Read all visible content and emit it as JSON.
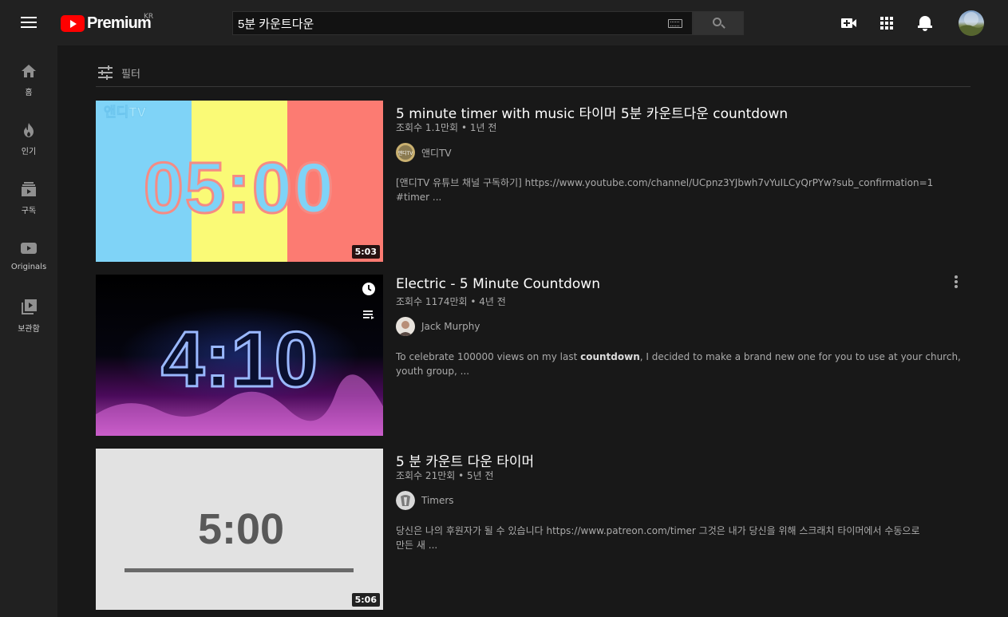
{
  "header": {
    "logo_text": "Premium",
    "logo_region": "KR",
    "search_value": "5분 카운트다운"
  },
  "sidebar": {
    "items": [
      {
        "label": "홈",
        "icon": "home-icon"
      },
      {
        "label": "인기",
        "icon": "fire-icon"
      },
      {
        "label": "구독",
        "icon": "subscriptions-icon"
      },
      {
        "label": "Originals",
        "icon": "originals-icon"
      },
      {
        "label": "보관함",
        "icon": "library-icon"
      }
    ]
  },
  "filter": {
    "label": "필터"
  },
  "results": [
    {
      "title": "5 minute timer with music 타이머 5분 카운트다운 countdown",
      "views": "조회수 1.1만회",
      "age": "1년 전",
      "channel": "앤디TV",
      "desc_line1": "[앤디TV 유튜브 채널 구독하기] https://www.youtube.com/channel/UCpnz3YJbwh7vYuILCyQrPYw?sub_confirmation=1",
      "desc_line2": "#timer ...",
      "duration": "5:03",
      "thumb_text": "05:00",
      "thumb_watermark": "앤디TV",
      "avatar_text": "앤디TV"
    },
    {
      "title": "Electric - 5 Minute Countdown",
      "views": "조회수 1174만회",
      "age": "4년 전",
      "channel": "Jack Murphy",
      "desc_before": "To celebrate 100000 views on my last ",
      "desc_bold": "countdown",
      "desc_after": ", I decided to make a brand new one for you to use at your church, youth group, ...",
      "thumb_text": "4:10"
    },
    {
      "title": "5 분 카운트 다운 타이머",
      "views": "조회수 21만회",
      "age": "5년 전",
      "channel": "Timers",
      "desc_line1": "당신은 나의 후원자가 될 수 있습니다 https://www.patreon.com/timer 그것은 내가 당신을 위해 스크래치 타이머에서 수동으로",
      "desc_line2": "만든 새 ...",
      "duration": "5:06",
      "thumb_text": "5:00"
    }
  ],
  "separator": "•"
}
